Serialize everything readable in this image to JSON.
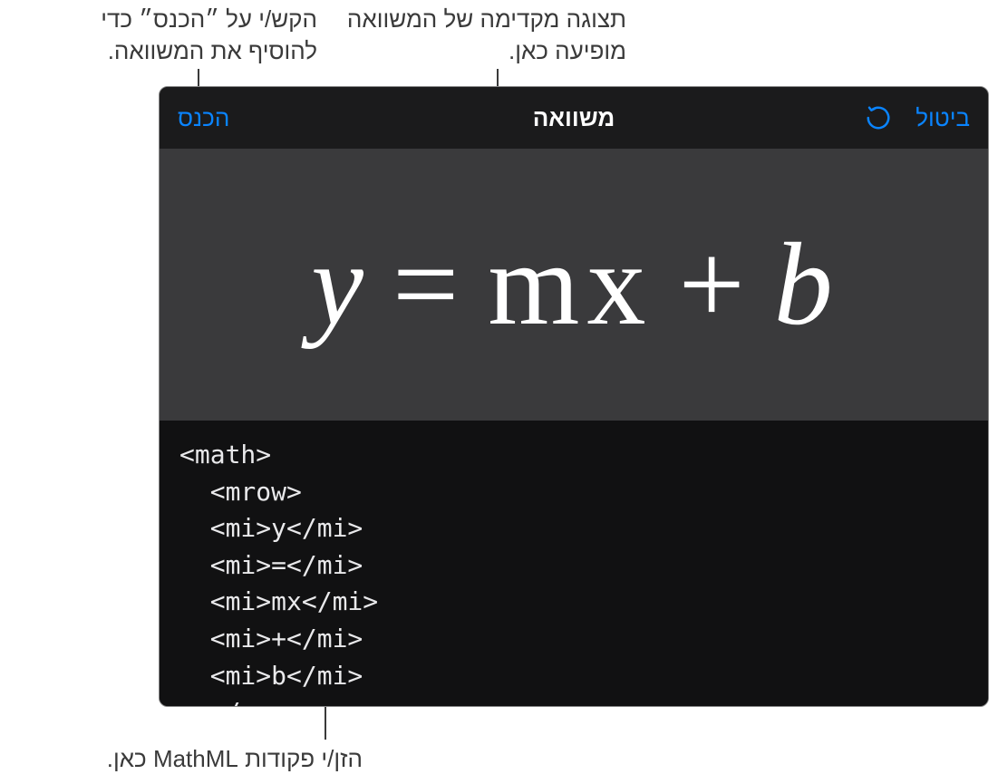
{
  "callouts": {
    "insert": "הקש/י על ״הכנס״ כדי להוסיף את המשוואה.",
    "preview": "תצוגה מקדימה של המשוואה מופיעה כאן.",
    "enterCode": "הזן/י פקודות MathML כאן."
  },
  "toolbar": {
    "cancel": "ביטול",
    "title": "משוואה",
    "insert": "הכנס",
    "redoIconName": "redo-icon"
  },
  "equation": {
    "y": "y",
    "eq": "=",
    "mx": "mx",
    "plus": "+",
    "b": "b"
  },
  "code": "<math>\n  <mrow>\n  <mi>y</mi>\n  <mi>=</mi>\n  <mi>mx</mi>\n  <mi>+</mi>\n  <mi>b</mi>\n  </mrow>"
}
